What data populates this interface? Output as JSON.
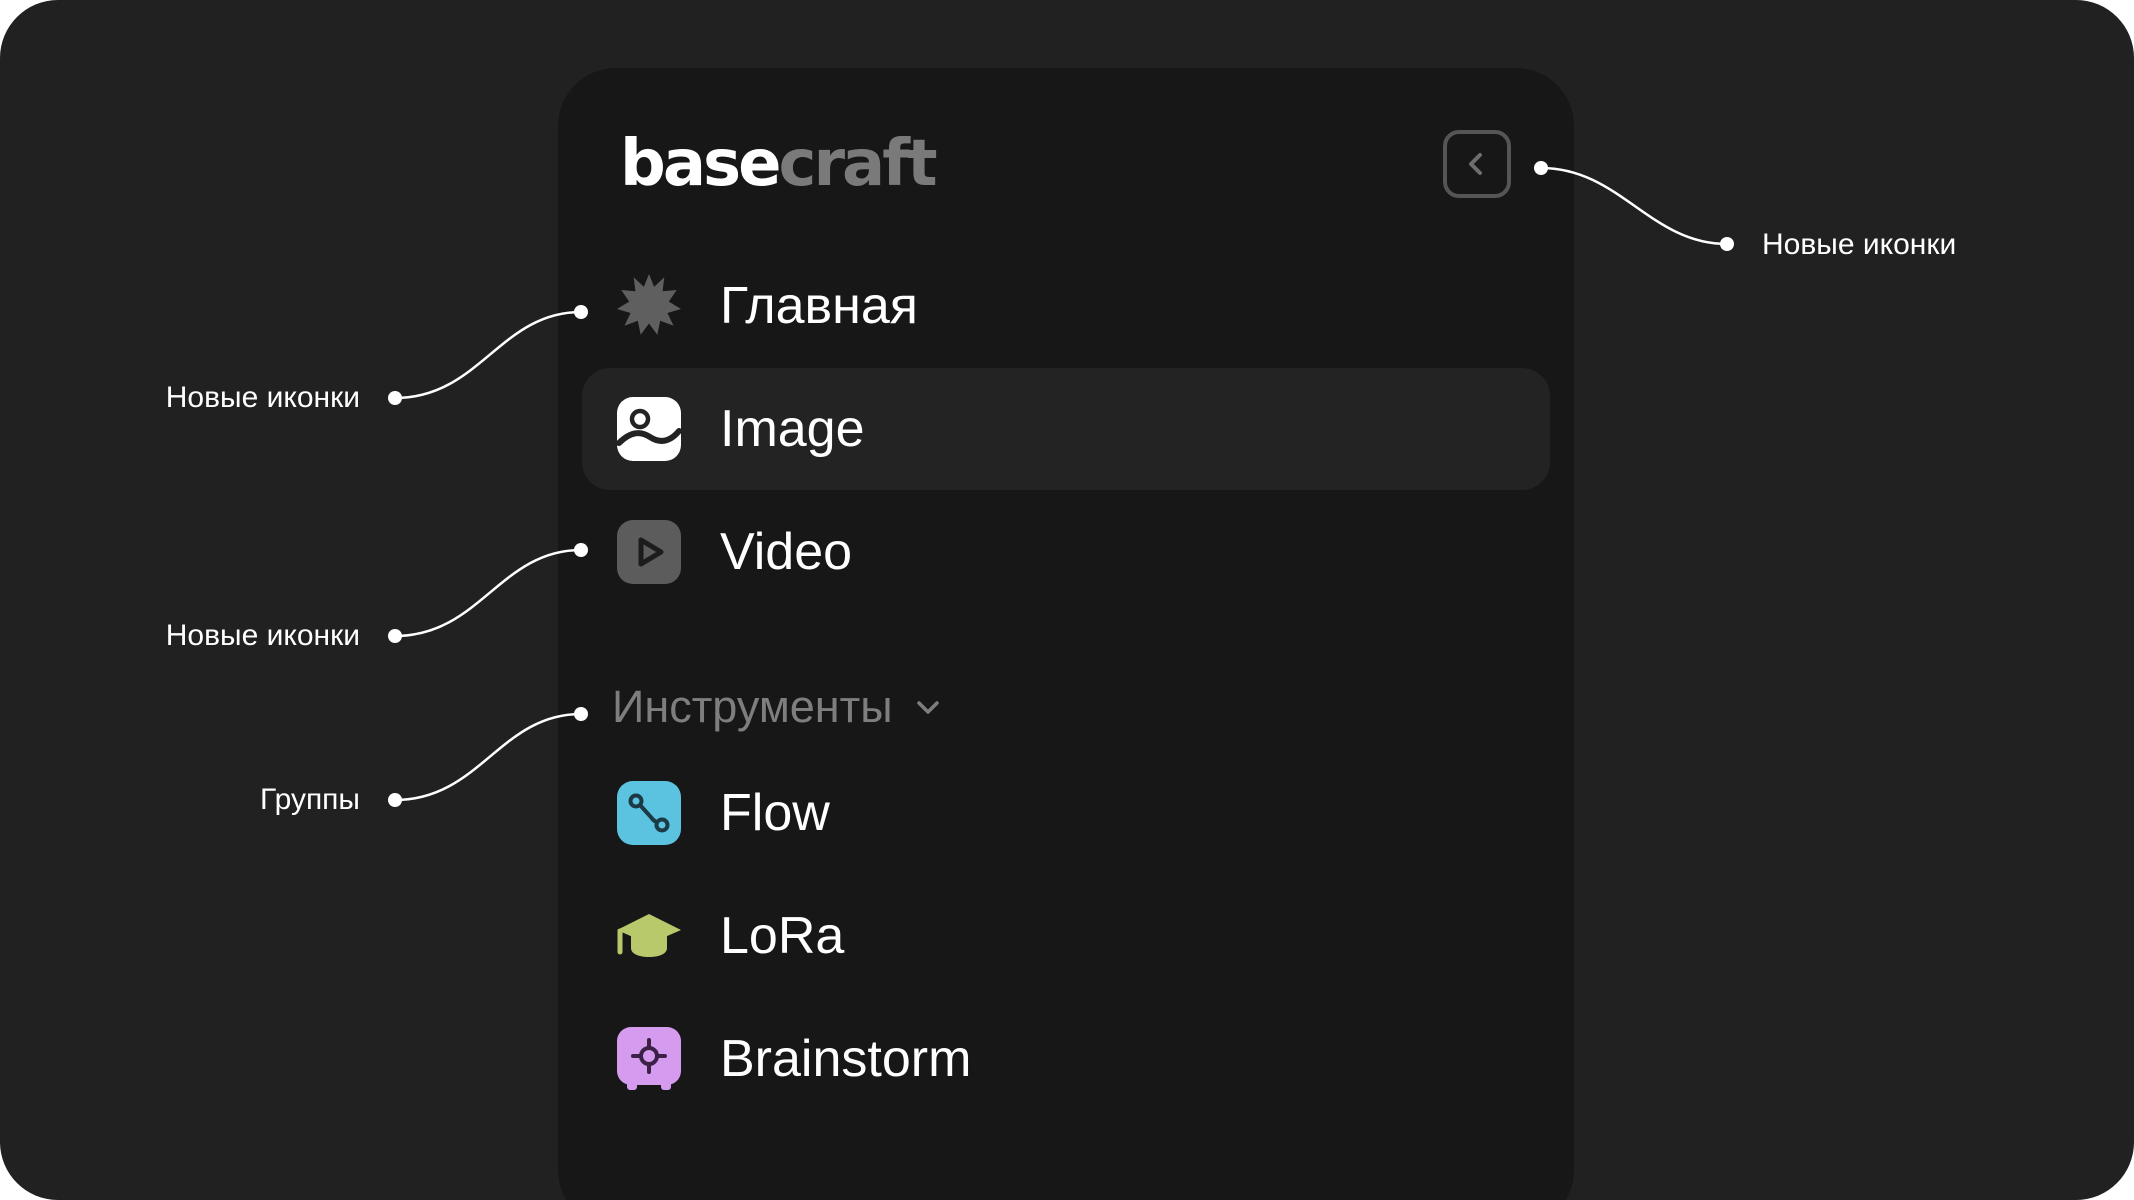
{
  "logo": {
    "part1": "base",
    "part2": "craft"
  },
  "nav": {
    "items": [
      {
        "label": "Главная",
        "icon": "sunburst-icon",
        "active": false
      },
      {
        "label": "Image",
        "icon": "image-icon",
        "active": true
      },
      {
        "label": "Video",
        "icon": "video-play-icon",
        "active": false
      }
    ]
  },
  "tools": {
    "group_label": "Инструменты",
    "items": [
      {
        "label": "Flow",
        "icon": "flow-icon",
        "color": "#5BC3E0"
      },
      {
        "label": "LoRa",
        "icon": "graduation-cap-icon",
        "color": "#B7C96B"
      },
      {
        "label": "Brainstorm",
        "icon": "brainstorm-icon",
        "color": "#D59BEF"
      }
    ]
  },
  "annotations": {
    "top_right": "Новые иконки",
    "left_1": "Новые иконки",
    "left_2": "Новые иконки",
    "left_3": "Группы"
  },
  "colors": {
    "background": "#212121",
    "panel": "#171717",
    "active_item": "#232323",
    "muted_text": "#7e7e7e"
  }
}
